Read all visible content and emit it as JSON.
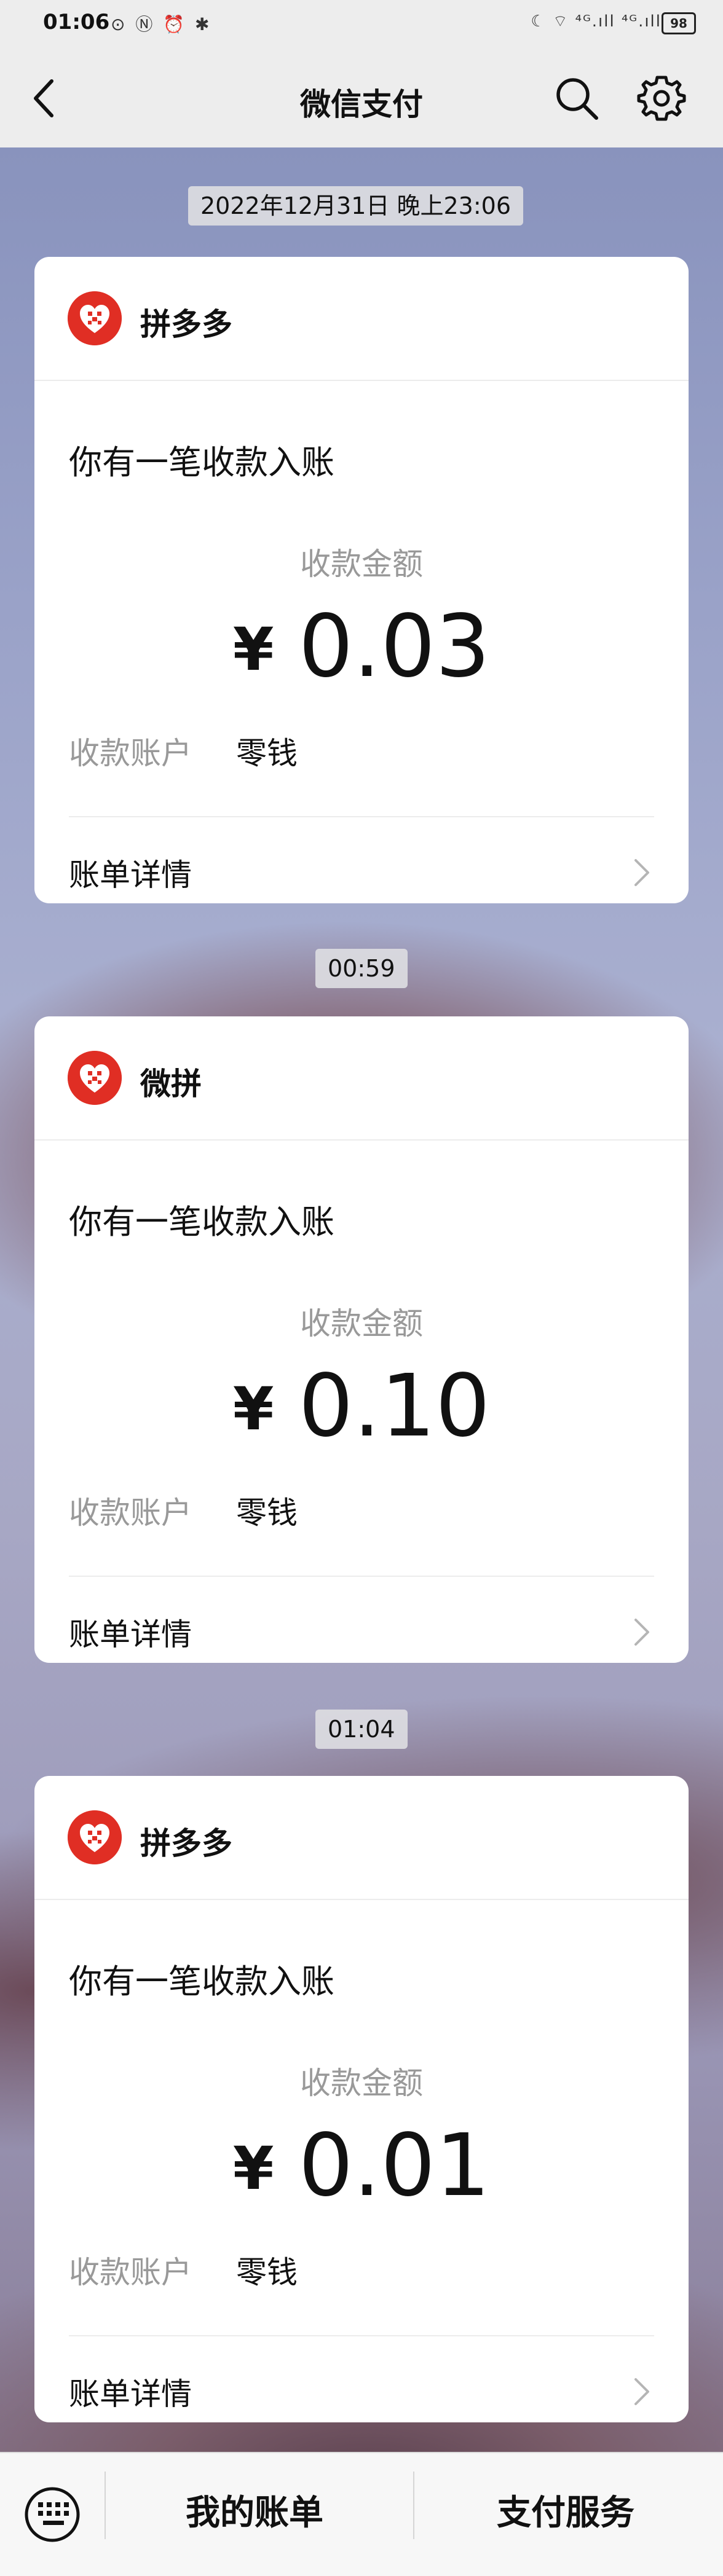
{
  "status_bar": {
    "time": "01:06",
    "left_icons": "⊙ Ⓝ ⏰ ✱",
    "right_icons": "☾ ⌔ ⁴ᴳ.ıll ⁴ᴳ.ıll",
    "battery": "98"
  },
  "nav": {
    "title": "微信支付"
  },
  "messages": [
    {
      "timestamp": "2022年12月31日 晚上23:06",
      "merchant": "拼多多",
      "notice": "你有一笔收款入账",
      "amount_label": "收款金额",
      "currency": "¥",
      "amount": "0.03",
      "account_label": "收款账户",
      "account_value": "零钱",
      "details_label": "账单详情"
    },
    {
      "timestamp": "00:59",
      "merchant": "微拼",
      "notice": "你有一笔收款入账",
      "amount_label": "收款金额",
      "currency": "¥",
      "amount": "0.10",
      "account_label": "收款账户",
      "account_value": "零钱",
      "details_label": "账单详情"
    },
    {
      "timestamp": "01:04",
      "merchant": "拼多多",
      "notice": "你有一笔收款入账",
      "amount_label": "收款金额",
      "currency": "¥",
      "amount": "0.01",
      "account_label": "收款账户",
      "account_value": "零钱",
      "details_label": "账单详情"
    }
  ],
  "bottom_bar": {
    "my_bills": "我的账单",
    "pay_services": "支付服务"
  },
  "colors": {
    "merchant_logo": "#e02e24",
    "bar_bg": "#ededed"
  }
}
